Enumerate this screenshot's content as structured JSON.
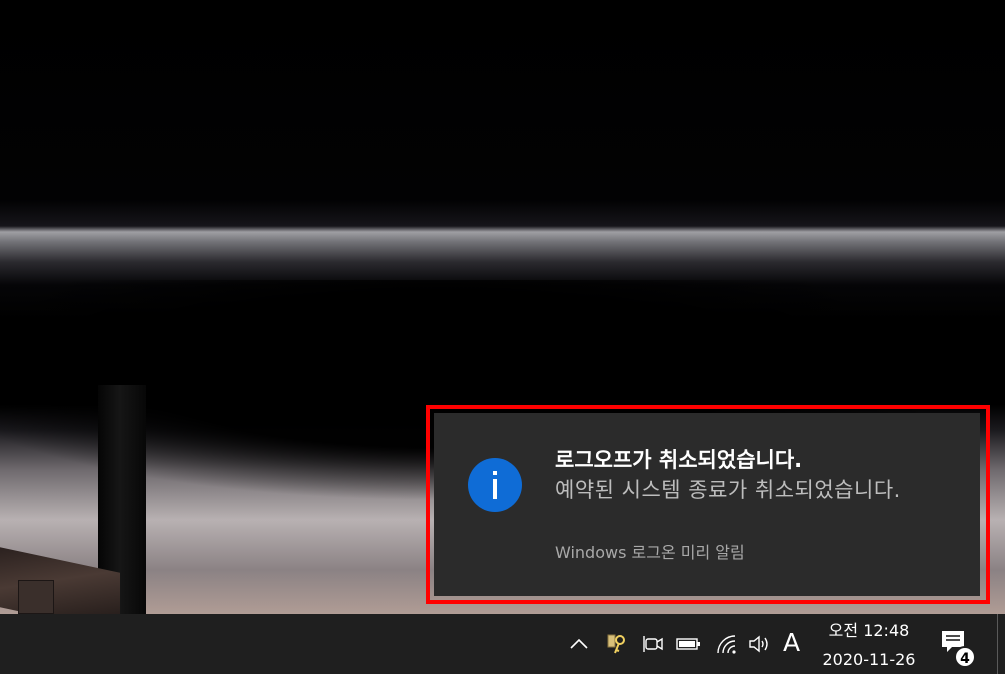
{
  "toast": {
    "title": "로그오프가 취소되었습니다.",
    "body": "예약된 시스템 종료가 취소되었습니다.",
    "source": "Windows 로그온 미리 알림",
    "icon": "info-icon",
    "accent_color": "#0f6cd6",
    "highlight_color": "#ff0000"
  },
  "taskbar": {
    "tray_icons": [
      "chevron-up-icon",
      "key-security-icon",
      "meet-now-icon",
      "battery-icon",
      "wifi-icon",
      "volume-icon"
    ],
    "ime_indicator": "A",
    "clock": {
      "time": "오전 12:48",
      "date": "2020-11-26"
    },
    "action_center": {
      "icon": "notification-icon",
      "badge": "4"
    }
  }
}
